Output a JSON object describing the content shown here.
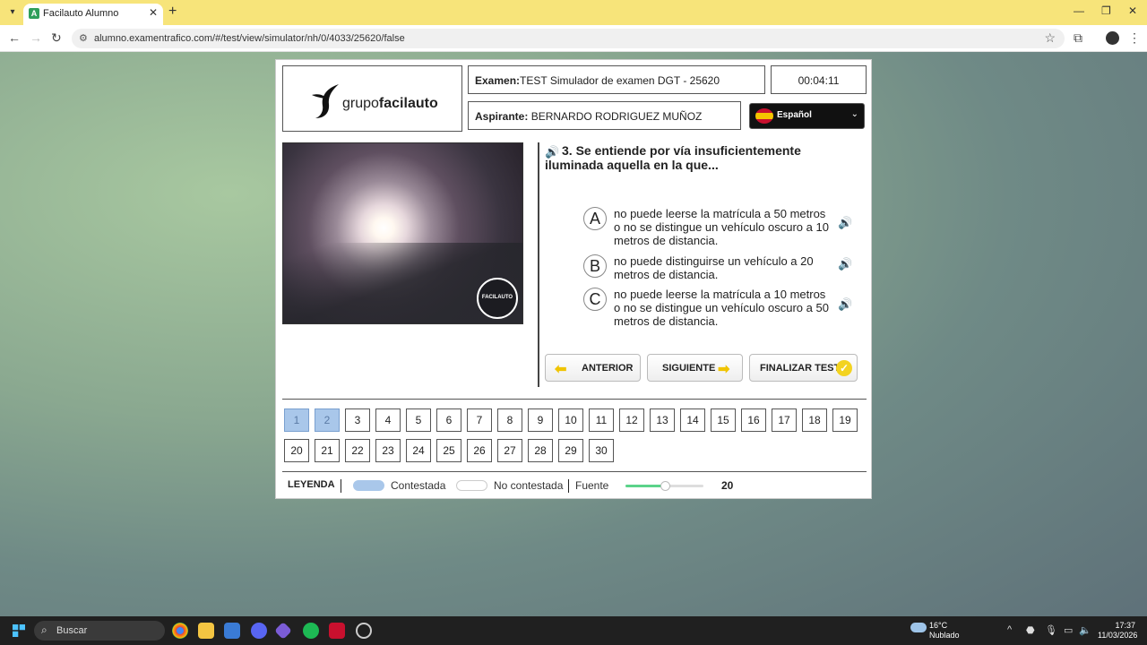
{
  "browser": {
    "tab_title": "Facilauto Alumno",
    "url": "alumno.examentrafico.com/#/test/view/simulator/nh/0/4033/25620/false"
  },
  "exam": {
    "logo_text_light": "grupo",
    "logo_text_bold": "facilauto",
    "exam_label": "Examen:",
    "exam_value": "TEST Simulador de examen DGT - 25620",
    "timer": "00:04:11",
    "candidate_label": "Aspirante:",
    "candidate_value": "BERNARDO RODRIGUEZ MUÑOZ",
    "language": "Español",
    "image_badge": "FACILAUTO",
    "question": "3. Se entiende por vía insuficientemente iluminada aquella en la que...",
    "options": [
      {
        "letter": "A",
        "text": "no puede leerse la matrícula a 50 metros o no se distingue un vehículo oscuro a 10 metros de distancia."
      },
      {
        "letter": "B",
        "text": "no puede distinguirse un vehículo a 20 metros de distancia."
      },
      {
        "letter": "C",
        "text": "no puede leerse la matrícula a 10 metros o no se distingue un vehículo oscuro a 50 metros de distancia."
      }
    ],
    "buttons": {
      "previous": "ANTERIOR",
      "next": "SIGUIENTE",
      "finish": "FINALIZAR TEST"
    },
    "question_numbers": [
      "1",
      "2",
      "3",
      "4",
      "5",
      "6",
      "7",
      "8",
      "9",
      "10",
      "11",
      "12",
      "13",
      "14",
      "15",
      "16",
      "17",
      "18",
      "19",
      "20",
      "21",
      "22",
      "23",
      "24",
      "25",
      "26",
      "27",
      "28",
      "29",
      "30"
    ],
    "answered": [
      "1",
      "2"
    ],
    "legend": {
      "title": "LEYENDA",
      "answered": "Contestada",
      "unanswered": "No contestada",
      "font_label": "Fuente",
      "font_value": "20",
      "font_slider_fraction": 0.5
    }
  },
  "taskbar": {
    "search": "Buscar",
    "weather_temp": "16°C",
    "weather_cond": "Nublado",
    "time": "17:37",
    "date": "11/03/2026"
  },
  "colors": {
    "tabbar": "#f7e47a",
    "answered": "#a9c7ea",
    "accent_yellow": "#f0c400",
    "slider": "#5bd38a"
  }
}
